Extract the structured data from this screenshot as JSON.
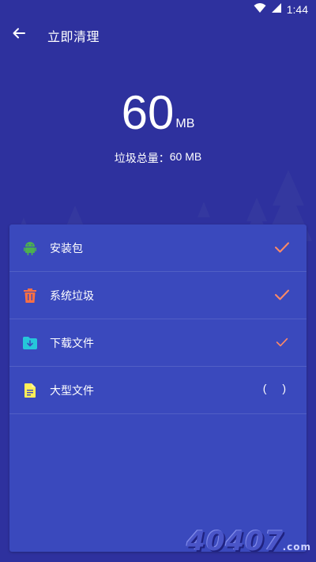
{
  "status_bar": {
    "time": "1:44",
    "icons": [
      "wifi-icon",
      "signal-icon"
    ]
  },
  "header": {
    "title": "立即清理",
    "back_icon": "arrow-back-icon"
  },
  "summary": {
    "size_value": "60",
    "size_unit": "MB",
    "total_label": "垃圾总量：",
    "total_value": "60 MB"
  },
  "items": [
    {
      "label": "安装包",
      "icon": "android-icon",
      "icon_color": "#4caf50",
      "state": "checked"
    },
    {
      "label": "系统垃圾",
      "icon": "trash-icon",
      "icon_color": "#ff7043",
      "state": "checked"
    },
    {
      "label": "下载文件",
      "icon": "download-folder-icon",
      "icon_color": "#26c6da",
      "state": "checked"
    },
    {
      "label": "大型文件",
      "icon": "document-icon",
      "icon_color": "#ffee58",
      "state": "pending",
      "status_text": "( )"
    }
  ],
  "colors": {
    "background": "#2e319e",
    "card": "#3a49bd",
    "check": "#ff8a65",
    "text": "#ffffff"
  },
  "watermark": {
    "text": "40407",
    "suffix": ".com"
  }
}
